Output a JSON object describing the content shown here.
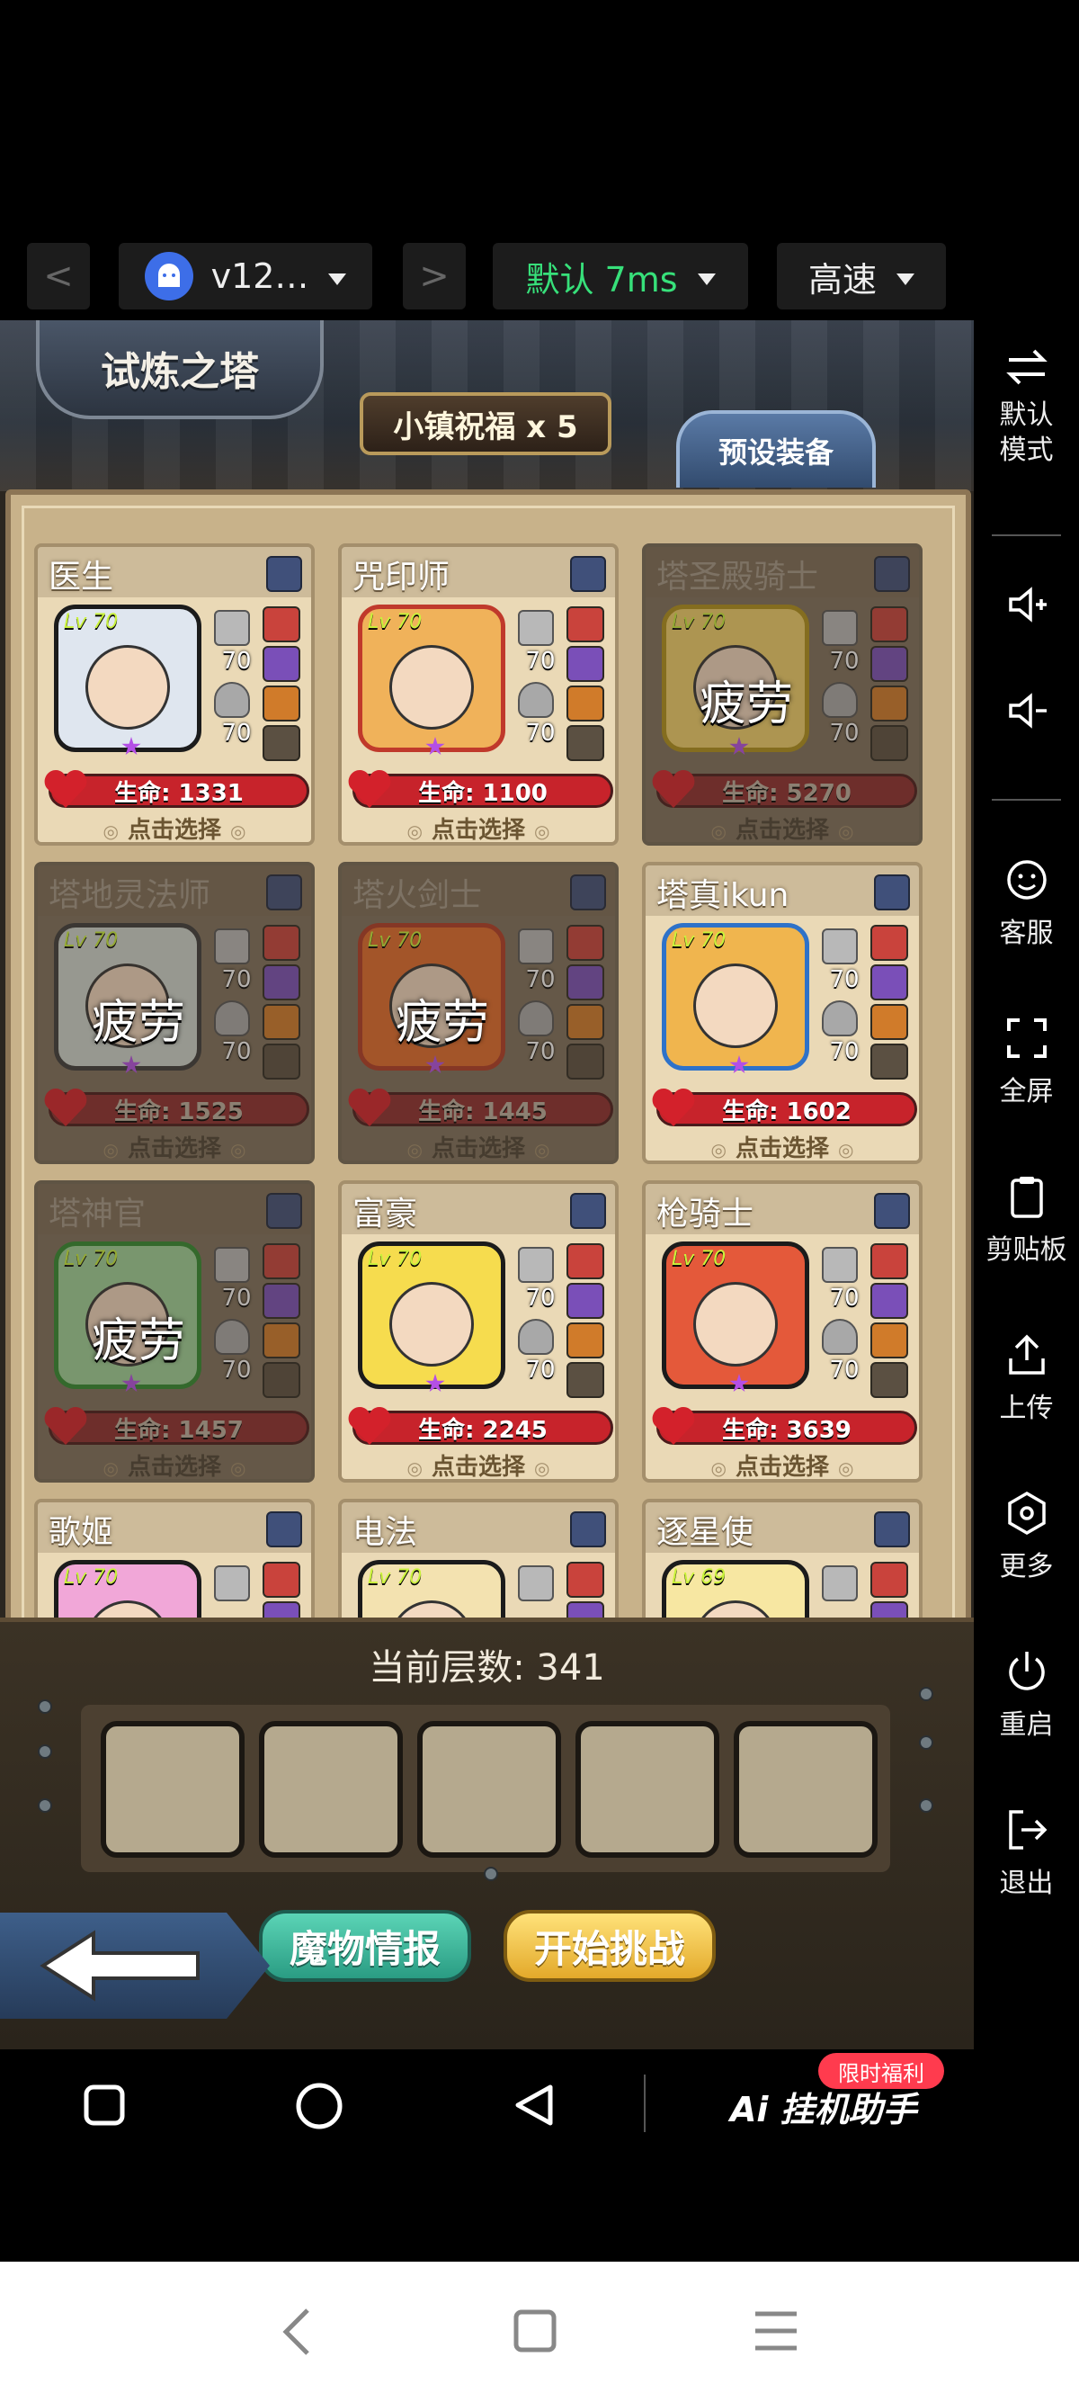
{
  "toolbar": {
    "back_glyph": "<",
    "forward_glyph": ">",
    "device_label": "v12…",
    "line_label": "默认 7ms",
    "speed_label": "高速",
    "line_color": "#37e07a"
  },
  "game": {
    "title": "试炼之塔",
    "blessing": "小镇祝福 x 5",
    "preset_button": "预设装备",
    "tired_label": "疲劳",
    "select_label": "点击选择",
    "level_label": "Lv 70",
    "heroes": [
      {
        "name": "医生",
        "level": "Lv 70",
        "atk": "70",
        "def": "70",
        "hp": "生命: 1331",
        "tired": false,
        "portrait_color": "#dfe6ef",
        "frame_color": "#1b1b1b"
      },
      {
        "name": "咒印师",
        "level": "Lv 70",
        "atk": "70",
        "def": "70",
        "hp": "生命: 1100",
        "tired": false,
        "portrait_color": "#f0b25a",
        "frame_color": "#c0392b"
      },
      {
        "name": "塔圣殿骑士",
        "level": "Lv 70",
        "atk": "70",
        "def": "70",
        "hp": "生命: 5270",
        "tired": true,
        "portrait_color": "#f2d26b",
        "frame_color": "#b0921b"
      },
      {
        "name": "塔地灵法师",
        "level": "Lv 70",
        "atk": "70",
        "def": "70",
        "hp": "生命: 1525",
        "tired": true,
        "portrait_color": "#cfd7d0",
        "frame_color": "#3a3a3a"
      },
      {
        "name": "塔火剑士",
        "level": "Lv 70",
        "atk": "70",
        "def": "70",
        "hp": "生命: 1445",
        "tired": true,
        "portrait_color": "#e36b2b",
        "frame_color": "#b23a25"
      },
      {
        "name": "塔真ikun",
        "level": "Lv 70",
        "atk": "70",
        "def": "70",
        "hp": "生命: 1602",
        "tired": false,
        "portrait_color": "#f0b54e",
        "frame_color": "#2e72c9"
      },
      {
        "name": "塔神官",
        "level": "Lv 70",
        "atk": "70",
        "def": "70",
        "hp": "生命: 1457",
        "tired": true,
        "portrait_color": "#9fd49a",
        "frame_color": "#2f8b2f"
      },
      {
        "name": "富豪",
        "level": "Lv 70",
        "atk": "70",
        "def": "70",
        "hp": "生命: 2245",
        "tired": false,
        "portrait_color": "#f6dc4e",
        "frame_color": "#1b1b1b"
      },
      {
        "name": "枪骑士",
        "level": "Lv 70",
        "atk": "70",
        "def": "70",
        "hp": "生命: 3639",
        "tired": false,
        "portrait_color": "#e4593a",
        "frame_color": "#1b1b1b"
      },
      {
        "name": "歌姬",
        "level": "Lv 70",
        "atk": "",
        "def": "",
        "hp": "",
        "tired": false,
        "portrait_color": "#f1a7d8",
        "frame_color": "#1b1b1b"
      },
      {
        "name": "电法",
        "level": "Lv 70",
        "atk": "",
        "def": "",
        "hp": "",
        "tired": false,
        "portrait_color": "#f3e2b0",
        "frame_color": "#1b1b1b"
      },
      {
        "name": "逐星使",
        "level": "Lv 69",
        "atk": "",
        "def": "",
        "hp": "",
        "tired": false,
        "portrait_color": "#f7e7a2",
        "frame_color": "#1b1b1b"
      }
    ],
    "current_floor": "当前层数: 341",
    "monster_info_button": "魔物情报",
    "start_button": "开始挑战"
  },
  "side_panel": {
    "items": [
      {
        "label": "默认\n模式",
        "icon": "swap-icon"
      },
      {
        "label": "",
        "icon": "volume-up-icon"
      },
      {
        "label": "",
        "icon": "volume-down-icon"
      },
      {
        "label": "客服",
        "icon": "support-icon"
      },
      {
        "label": "全屏",
        "icon": "fullscreen-icon"
      },
      {
        "label": "剪贴板",
        "icon": "clipboard-icon"
      },
      {
        "label": "上传",
        "icon": "upload-icon"
      },
      {
        "label": "更多",
        "icon": "more-icon"
      },
      {
        "label": "重启",
        "icon": "power-icon"
      },
      {
        "label": "退出",
        "icon": "exit-icon"
      }
    ]
  },
  "cloud_nav": {
    "brand": "Ai 挂机助手",
    "badge": "限时福利"
  },
  "system_nav": {
    "back_icon": "back-icon",
    "home_icon": "home-icon",
    "menu_icon": "menu-icon"
  }
}
